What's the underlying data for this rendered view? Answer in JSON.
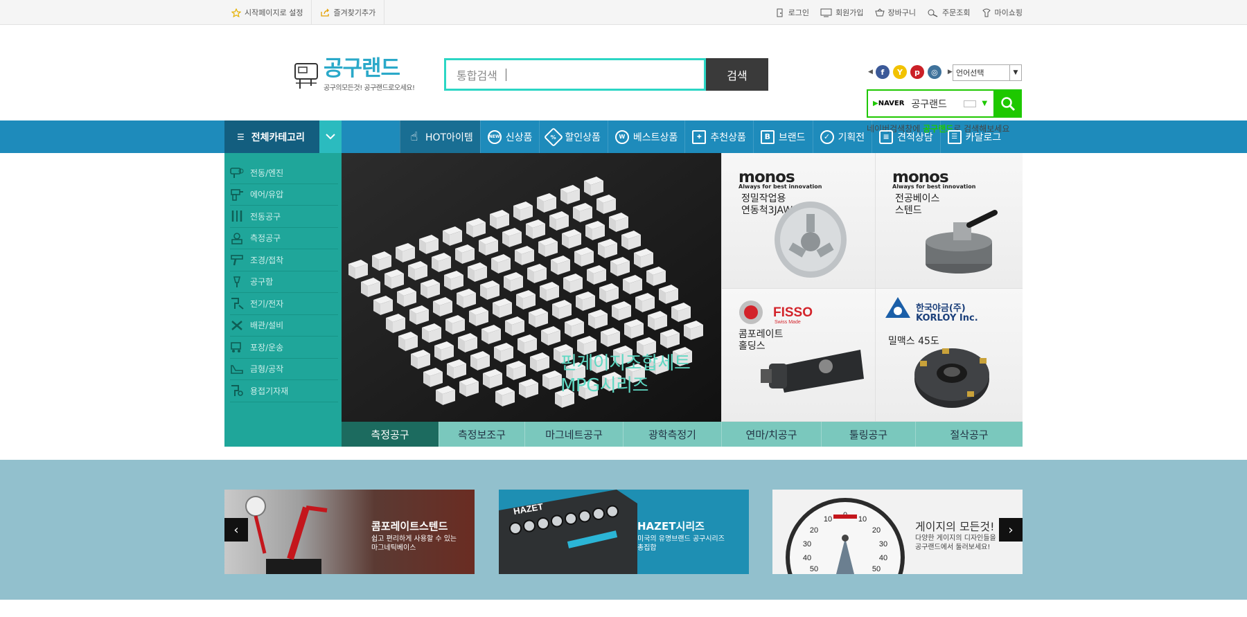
{
  "topbar": {
    "left": [
      {
        "label": "시작페이지로 설정",
        "icon": "star-icon"
      },
      {
        "label": "즐겨찾기추가",
        "icon": "bookmark-icon"
      }
    ],
    "right": [
      {
        "label": "로그인",
        "icon": "login-icon"
      },
      {
        "label": "회원가입",
        "icon": "monitor-icon"
      },
      {
        "label": "장바구니",
        "icon": "cart-icon"
      },
      {
        "label": "주문조회",
        "icon": "truck-icon"
      },
      {
        "label": "마이쇼핑",
        "icon": "person-icon"
      }
    ]
  },
  "header": {
    "logo_title": "공구랜드",
    "logo_sub": "공구의모든것! 공구랜드로오세요!",
    "search_placeholder": "통합검색",
    "search_button": "검색",
    "language_select": "언어선택",
    "naver_logo": "NAVER",
    "naver_query": "공구랜드",
    "naver_caption_pre": "네이버검색창에 ",
    "naver_caption_em": "공구랜드",
    "naver_caption_post": "로 검색해보세요"
  },
  "social": [
    {
      "icon": "facebook-icon",
      "glyph": "f",
      "color": "#3b5998"
    },
    {
      "icon": "yellow-id-icon",
      "glyph": "Y",
      "color": "#f2c200"
    },
    {
      "icon": "pinterest-icon",
      "glyph": "p",
      "color": "#cb2027"
    },
    {
      "icon": "instagram-icon",
      "glyph": "◎",
      "color": "#3f729b"
    }
  ],
  "nav": {
    "all_category": "전체카테고리",
    "items": [
      {
        "label": "HOT아이템",
        "icon": "hand-pointer-icon",
        "glyph": "☝",
        "active": true
      },
      {
        "label": "신상품",
        "icon": "new-badge-icon",
        "glyph": "NEW"
      },
      {
        "label": "할인상품",
        "icon": "tag-icon",
        "glyph": "%"
      },
      {
        "label": "베스트상품",
        "icon": "best-w-icon",
        "glyph": "W"
      },
      {
        "label": "추천상품",
        "icon": "gift-icon",
        "glyph": "✚"
      },
      {
        "label": "브랜드",
        "icon": "brand-b-icon",
        "glyph": "B"
      },
      {
        "label": "기획전",
        "icon": "check-circle-icon",
        "glyph": "✓"
      },
      {
        "label": "견적상담",
        "icon": "chat-icon",
        "glyph": "≡"
      },
      {
        "label": "카달로그",
        "icon": "catalog-icon",
        "glyph": "☰"
      }
    ]
  },
  "sidebar": [
    {
      "label": "전동/엔진",
      "icon": "power-tool-icon"
    },
    {
      "label": "에어/유압",
      "icon": "air-tool-icon"
    },
    {
      "label": "전동공구",
      "icon": "hand-tools-icon"
    },
    {
      "label": "측정공구",
      "icon": "measure-icon"
    },
    {
      "label": "조경/접착",
      "icon": "glue-gun-icon"
    },
    {
      "label": "공구함",
      "icon": "toolbox-icon"
    },
    {
      "label": "전기/전자",
      "icon": "electric-icon"
    },
    {
      "label": "배관/설비",
      "icon": "pipe-icon"
    },
    {
      "label": "포장/운송",
      "icon": "cart-truck-icon"
    },
    {
      "label": "금형/공작",
      "icon": "mold-icon"
    },
    {
      "label": "용접기자재",
      "icon": "welding-icon"
    }
  ],
  "hero": {
    "line1": "핀게이지조합세트",
    "line2": "MPG시리즈"
  },
  "tiles": [
    {
      "brand": "monos",
      "brand_sub": "Always for best innovation",
      "desc1": "정밀작업용",
      "desc2": "연동척3JAW"
    },
    {
      "brand": "monos",
      "brand_sub": "Always for best innovation",
      "desc1": "전공베이스",
      "desc2": "스텐드"
    },
    {
      "brand": "FISSO",
      "brand_sub": "Swiss Made",
      "desc1": "콤포레이트",
      "desc2": "홀딩스"
    },
    {
      "brand": "한국야금(주)",
      "brand_sub": "KORLOY Inc.",
      "desc1": "밀맥스 45도",
      "desc2": ""
    }
  ],
  "tabs": [
    "측정공구",
    "측정보조구",
    "마그네트공구",
    "광학측정기",
    "연마/치공구",
    "툴링공구",
    "절삭공구"
  ],
  "promos": [
    {
      "title": "콤포레이트스텐드",
      "sub1": "쉽고 편리하게 사용할 수 있는",
      "sub2": "마그네틱베이스"
    },
    {
      "title": "HAZET시리즈",
      "sub1": "미국의 유명브랜드 공구시리즈",
      "sub2": "총집합"
    },
    {
      "title": "게이지의 모든것!",
      "sub1": "다양한 게이지의 디자인들을",
      "sub2": "공구랜드에서 둘러보세요!"
    }
  ],
  "promo_nav": {
    "prev": "‹",
    "next": "›"
  },
  "gauge_labels": [
    "0",
    "10",
    "20",
    "30",
    "40",
    "50"
  ]
}
